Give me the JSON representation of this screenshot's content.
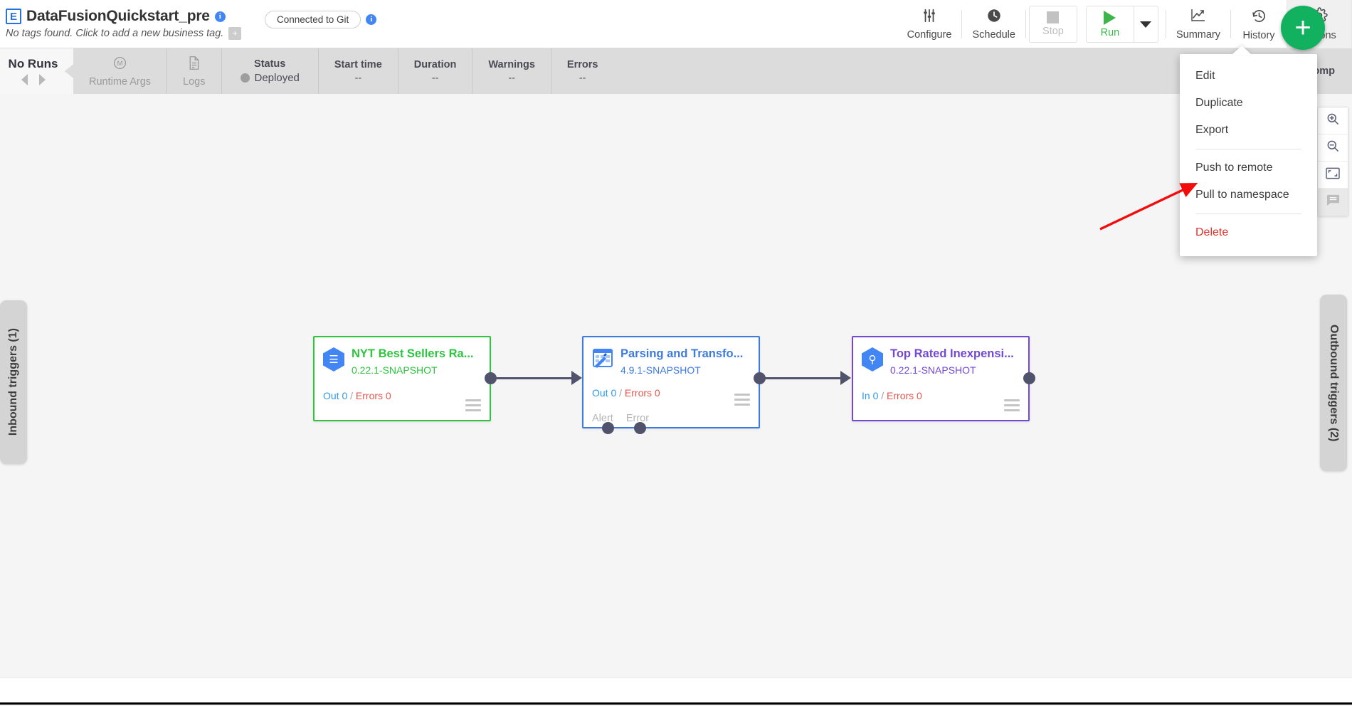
{
  "header": {
    "pipeline_icon": "pipeline-studio-icon",
    "pipeline_name": "DataFusionQuickstart_pre",
    "info_icon": "info-icon",
    "tags_text": "No tags found. Click to add a new business tag.",
    "tag_add_label": "+",
    "git_badge": "Connected to Git",
    "git_info_icon": "info-icon",
    "tools": [
      {
        "label": "Configure",
        "icon": "sliders-icon"
      },
      {
        "label": "Schedule",
        "icon": "clock-icon"
      }
    ],
    "stop_label": "Stop",
    "run_label": "Run",
    "run_caret_icon": "chevron-down-icon",
    "summary": {
      "label": "Summary",
      "icon": "chart-line-icon"
    },
    "history": {
      "label": "History",
      "icon": "history-clock-icon"
    },
    "actions": {
      "label": "Actions",
      "icon": "gear-icon"
    },
    "fab_label": "+"
  },
  "actions_menu": {
    "items": [
      {
        "label": "Edit",
        "type": "normal"
      },
      {
        "label": "Duplicate",
        "type": "normal"
      },
      {
        "label": "Export",
        "type": "normal"
      },
      {
        "label": "Push to remote",
        "type": "normal"
      },
      {
        "label": "Pull to namespace",
        "type": "normal"
      },
      {
        "label": "Delete",
        "type": "danger"
      }
    ]
  },
  "statusbar": {
    "runs_label": "No Runs",
    "prev_icon": "chevron-left-icon",
    "next_icon": "chevron-right-icon",
    "runtime_args": {
      "label": "Runtime Args",
      "icon": "macro-icon"
    },
    "logs": {
      "label": "Logs",
      "icon": "document-icon"
    },
    "cells": [
      {
        "header": "Status",
        "value": "Deployed",
        "has_dot": true
      },
      {
        "header": "Start time",
        "value": "--",
        "has_dot": false
      },
      {
        "header": "Duration",
        "value": "--",
        "has_dot": false
      },
      {
        "header": "Warnings",
        "value": "--",
        "has_dot": false
      },
      {
        "header": "Errors",
        "value": "--",
        "has_dot": false
      }
    ],
    "right_label": "Comp"
  },
  "canvas": {
    "inbound_triggers": "Inbound triggers (1)",
    "outbound_triggers": "Outbound triggers (2)",
    "zoom_controls": [
      {
        "name": "zoom-in-icon"
      },
      {
        "name": "zoom-out-icon"
      },
      {
        "name": "fit-to-screen-icon"
      },
      {
        "name": "comments-icon"
      }
    ],
    "nodes": [
      {
        "title": "NYT Best Sellers Ra...",
        "version": "0.22.1-SNAPSHOT",
        "metric_left_label": "Out 0",
        "metric_right_label": "Errors 0",
        "color": "green",
        "icon": "bigquery-source-icon",
        "ports": []
      },
      {
        "title": "Parsing and Transfo...",
        "version": "4.9.1-SNAPSHOT",
        "metric_left_label": "Out 0",
        "metric_right_label": "Errors 0",
        "color": "blue",
        "icon": "wrangler-transform-icon",
        "ports": [
          "Alert",
          "Error"
        ]
      },
      {
        "title": "Top Rated Inexpensi...",
        "version": "0.22.1-SNAPSHOT",
        "metric_left_label": "In 0",
        "metric_right_label": "Errors 0",
        "color": "purple",
        "icon": "bigquery-sink-icon",
        "ports": []
      }
    ],
    "metric_separator": "/"
  },
  "colors": {
    "green": "#2ec43f",
    "blue": "#3d7be0",
    "purple": "#7149d6",
    "accent_green": "#11b15f",
    "error_red": "#e8554f",
    "delete_red": "#e1312b",
    "annotation_red": "#f20c0c"
  }
}
